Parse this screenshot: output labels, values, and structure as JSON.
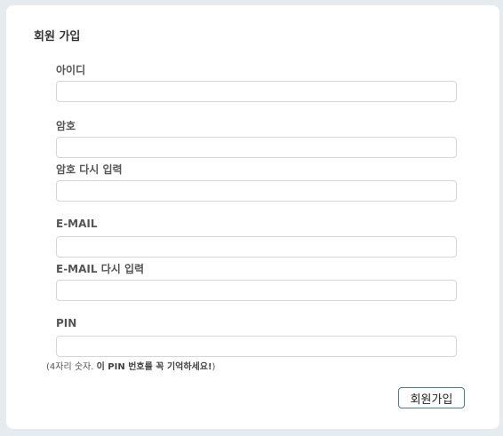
{
  "form": {
    "title": "회원 가입",
    "fields": [
      {
        "label": "아이디",
        "value": ""
      },
      {
        "label": "암호",
        "value": ""
      },
      {
        "label": "암호 다시 입력",
        "value": ""
      },
      {
        "label": "E-MAIL",
        "value": ""
      },
      {
        "label": "E-MAIL 다시 입력",
        "value": ""
      },
      {
        "label": "PIN",
        "value": ""
      }
    ],
    "pin_hint_prefix": "(4자리 숫자. ",
    "pin_hint_bold": "이 PIN 번호를 꼭 기억하세요!",
    "pin_hint_suffix": ")",
    "submit_label": "회원가입"
  }
}
